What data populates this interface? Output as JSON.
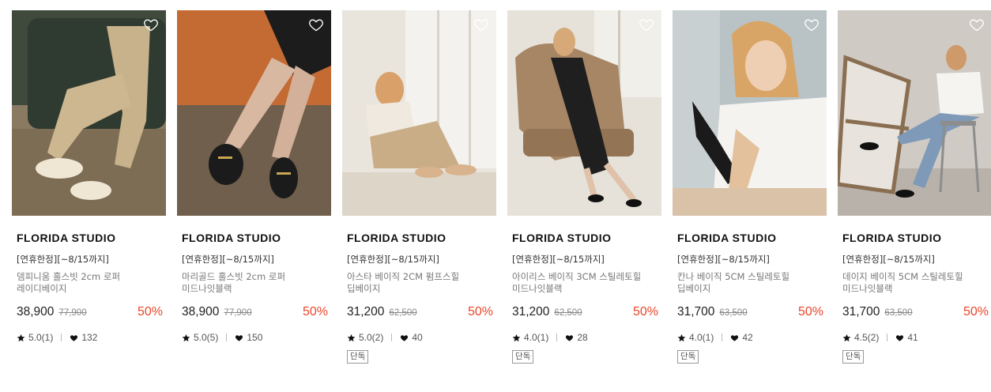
{
  "products": [
    {
      "brand": "FLORIDA STUDIO",
      "promo": "[연휴한정][~8/15까지]",
      "name": "뎀피니움 홀스빗 2cm 로퍼 레이디베이지",
      "price": "38,900",
      "original_price": "77,900",
      "discount": "50%",
      "rating": "5.0(1)",
      "likes": "132",
      "tag": ""
    },
    {
      "brand": "FLORIDA STUDIO",
      "promo": "[연휴한정][~8/15까지]",
      "name": "마리골드 홀스빗 2cm 로퍼 미드나잇블랙",
      "price": "38,900",
      "original_price": "77,900",
      "discount": "50%",
      "rating": "5.0(5)",
      "likes": "150",
      "tag": ""
    },
    {
      "brand": "FLORIDA STUDIO",
      "promo": "[연휴한정][~8/15까지]",
      "name": "아스타 베이직 2CM 펌프스힐 딥베이지",
      "price": "31,200",
      "original_price": "62,500",
      "discount": "50%",
      "rating": "5.0(2)",
      "likes": "40",
      "tag": "단독"
    },
    {
      "brand": "FLORIDA STUDIO",
      "promo": "[연휴한정][~8/15까지]",
      "name": "아이리스 베이직 3CM 스틸레토힐 미드나잇블랙",
      "price": "31,200",
      "original_price": "62,500",
      "discount": "50%",
      "rating": "4.0(1)",
      "likes": "28",
      "tag": "단독"
    },
    {
      "brand": "FLORIDA STUDIO",
      "promo": "[연휴한정][~8/15까지]",
      "name": "칸나 베이직 5CM 스틸레토힐 딥베이지",
      "price": "31,700",
      "original_price": "63,500",
      "discount": "50%",
      "rating": "4.0(1)",
      "likes": "42",
      "tag": "단독"
    },
    {
      "brand": "FLORIDA STUDIO",
      "promo": "[연휴한정][~8/15까지]",
      "name": "데이지 베이직 5CM 스틸레토힐 미드나잇블랙",
      "price": "31,700",
      "original_price": "63,500",
      "discount": "50%",
      "rating": "4.5(2)",
      "likes": "41",
      "tag": "단독"
    }
  ],
  "colors": {
    "discount": "#e8472a",
    "brand_text": "#111111",
    "name_text": "#777777"
  },
  "icons": {
    "wishlist": "heart-outline-icon",
    "rating": "star-icon",
    "likes": "heart-filled-icon"
  }
}
